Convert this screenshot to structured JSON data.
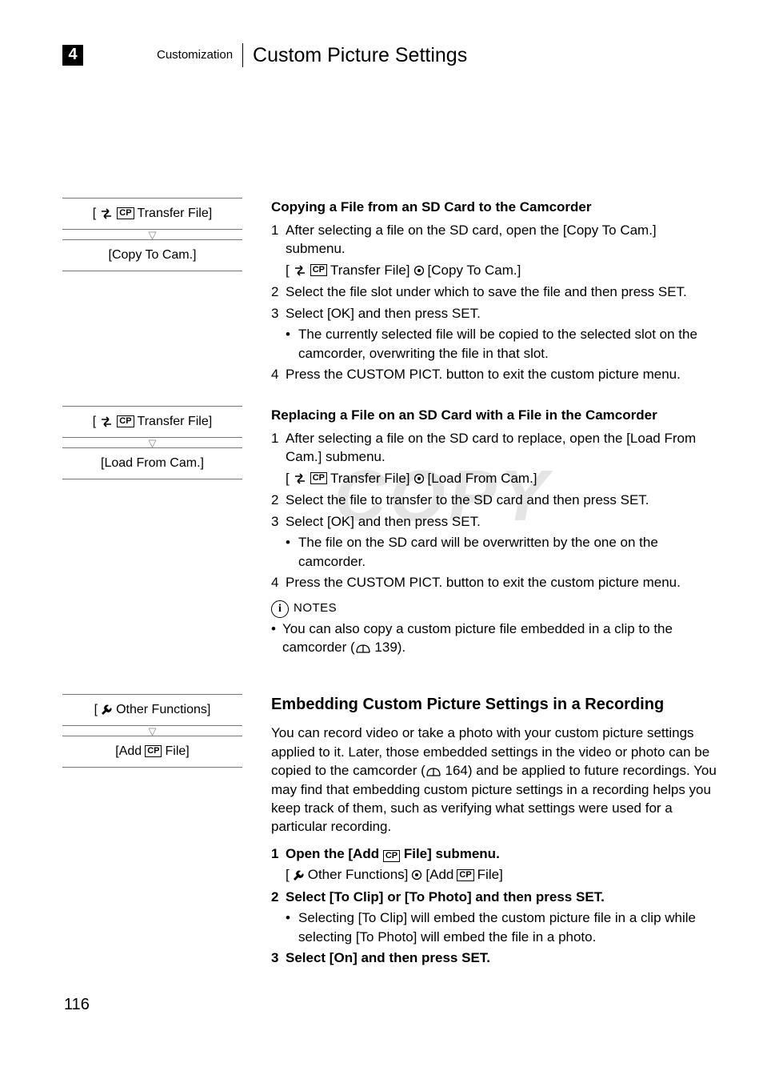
{
  "header": {
    "chapter_num": "4",
    "chapter_label": "Customization",
    "page_title": "Custom Picture Settings"
  },
  "sidebar": {
    "box1": {
      "a": "Transfer File]",
      "b": "[Copy To Cam.]"
    },
    "box2": {
      "a": "Transfer File]",
      "b": "[Load From Cam.]"
    },
    "box3": {
      "a": "Other Functions]",
      "b_pre": "[Add ",
      "b_post": " File]"
    }
  },
  "sec1": {
    "title": "Copying a File from an SD Card to the Camcorder",
    "s1n": "1",
    "s1t": "After selecting a file on the SD card, open the [Copy To Cam.] submenu.",
    "path1a": "Transfer File]",
    "path1b": "[Copy To Cam.]",
    "s2n": "2",
    "s2t": "Select the file slot under which to save the file and then press SET.",
    "s3n": "3",
    "s3t": "Select [OK] and then press SET.",
    "b1": "The currently selected file will be copied to the selected slot on the camcorder, overwriting the file in that slot.",
    "s4n": "4",
    "s4t": "Press the CUSTOM PICT. button to exit the custom picture menu."
  },
  "sec2": {
    "title": "Replacing a File on an SD Card with a File in the Camcorder",
    "s1n": "1",
    "s1t": "After selecting a file on the SD card to replace, open the [Load From Cam.] submenu.",
    "path1a": "Transfer File]",
    "path1b": "[Load From Cam.]",
    "s2n": "2",
    "s2t": "Select the file to transfer to the SD card and then press SET.",
    "s3n": "3",
    "s3t": "Select [OK] and then press SET.",
    "b1": "The file on the SD card will be overwritten by the one on the camcorder.",
    "s4n": "4",
    "s4t": "Press the CUSTOM PICT. button to exit the custom picture menu."
  },
  "notes": {
    "label": "NOTES",
    "n1a": "You can also copy a custom picture file embedded in a clip to the camcorder (",
    "n1b": " 139)."
  },
  "sec3": {
    "title": "Embedding Custom Picture Settings in a Recording",
    "p1a": "You can record video or take a photo with your custom picture settings applied to it. Later, those embedded settings in the video or photo can be copied to the camcorder (",
    "p1b": " 164) and be applied to future recordings. You may find that embedding custom picture settings in a recording helps you keep track of them, such as verifying what settings were used for a particular recording.",
    "s1n": "1",
    "s1t_pre": "Open the [Add ",
    "s1t_post": " File] submenu.",
    "path1a": "Other Functions]",
    "path1b_pre": "[Add ",
    "path1b_post": " File]",
    "s2n": "2",
    "s2t": "Select [To Clip] or [To Photo] and then press SET.",
    "b1": "Selecting [To Clip] will embed the custom picture file in a clip while selecting [To Photo] will embed the file in a photo.",
    "s3n": "3",
    "s3t": "Select [On] and then press SET."
  },
  "watermark": "COPY",
  "page_num": "116",
  "icons": {
    "cp": "CP"
  }
}
